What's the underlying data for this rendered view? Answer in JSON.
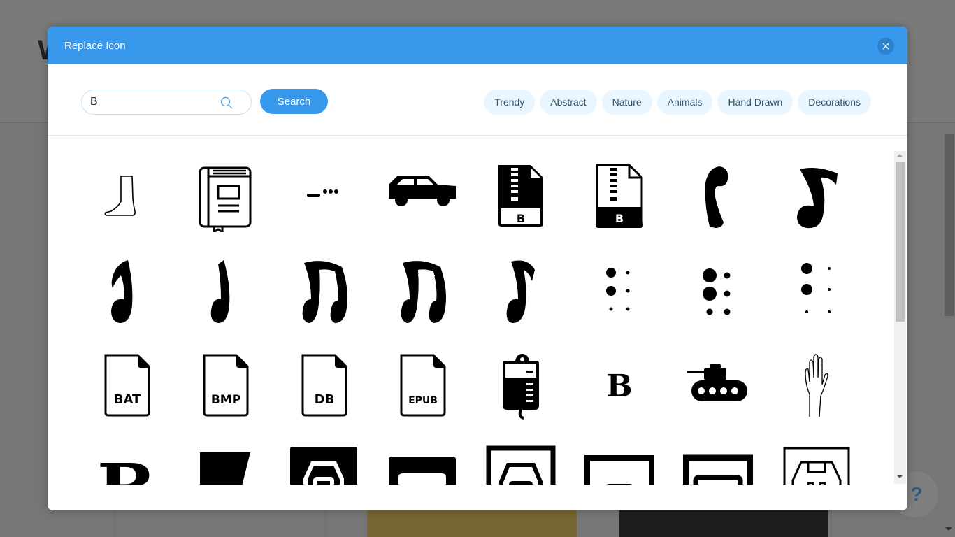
{
  "background": {
    "heading_fragment": "W",
    "help_label": "?"
  },
  "modal": {
    "title": "Replace Icon",
    "close_icon": "close-icon"
  },
  "search": {
    "value": "B",
    "placeholder": "",
    "button_label": "Search"
  },
  "tags": [
    "Trendy",
    "Abstract",
    "Nature",
    "Animals",
    "Hand Drawn",
    "Decorations"
  ],
  "icons": [
    {
      "name": "boot-outline-icon"
    },
    {
      "name": "book-icon"
    },
    {
      "name": "morse-b-icon"
    },
    {
      "name": "car-icon"
    },
    {
      "name": "zip-file-b-icon"
    },
    {
      "name": "zip-file-b-filled-icon"
    },
    {
      "name": "music-note-head-icon"
    },
    {
      "name": "music-eighth-note-curl-icon"
    },
    {
      "name": "music-note-flag-icon"
    },
    {
      "name": "music-quarter-note-icon"
    },
    {
      "name": "music-beamed-notes-icon"
    },
    {
      "name": "music-double-beamed-notes-icon"
    },
    {
      "name": "music-eighth-note-icon"
    },
    {
      "name": "braille-b-icon"
    },
    {
      "name": "braille-b-bold-icon"
    },
    {
      "name": "braille-b-light-icon"
    },
    {
      "name": "bat-file-icon",
      "label": "BAT"
    },
    {
      "name": "bmp-file-icon",
      "label": "BMP"
    },
    {
      "name": "db-file-icon",
      "label": "DB"
    },
    {
      "name": "epub-file-icon",
      "label": "EPUB"
    },
    {
      "name": "iv-blood-bag-icon"
    },
    {
      "name": "letter-b-icon",
      "label": "B"
    },
    {
      "name": "tank-icon"
    },
    {
      "name": "raised-hand-icon"
    },
    {
      "name": "bold-letter-b-icon",
      "label": "B"
    },
    {
      "name": "flag-banner-icon"
    },
    {
      "name": "usb-b-filled-icon"
    },
    {
      "name": "usb-mini-icon"
    },
    {
      "name": "usb-b-outline-icon"
    },
    {
      "name": "usb-micro-icon"
    },
    {
      "name": "usb-port-icon"
    },
    {
      "name": "usb-b-thin-icon"
    }
  ],
  "scroll": {
    "position": 0
  }
}
